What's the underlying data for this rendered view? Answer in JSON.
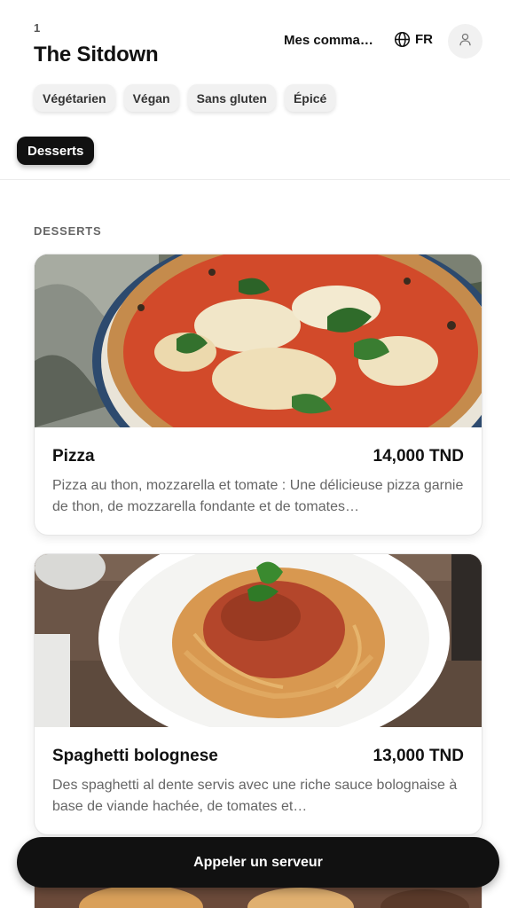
{
  "header": {
    "table_number": "1",
    "title": "The Sitdown",
    "orders_label": "Mes commandes",
    "language": "FR",
    "globe_icon": "globe-icon",
    "account_icon": "user-icon"
  },
  "filters": [
    "Végétarien",
    "Végan",
    "Sans gluten",
    "Épicé"
  ],
  "categories": [
    {
      "label": "Desserts",
      "active": true
    }
  ],
  "section": {
    "title": "DESSERTS"
  },
  "items": [
    {
      "name": "Pizza",
      "price": "14,000 TND",
      "description": "Pizza au thon, mozzarella et tomate : Une délicieuse pizza garnie de thon, de mozzarella fondante et de tomates…",
      "image": "pizza-photo"
    },
    {
      "name": "Spaghetti bolognese",
      "price": "13,000 TND",
      "description": "Des spaghetti al dente servis avec une riche sauce bolognaise à base de viande hachée, de tomates et…",
      "image": "spaghetti-photo"
    }
  ],
  "actions": {
    "call_waiter": "Appeler un serveur"
  },
  "colors": {
    "primary": "#111111",
    "chip_bg": "#f1f1f1",
    "muted_text": "#666666"
  }
}
